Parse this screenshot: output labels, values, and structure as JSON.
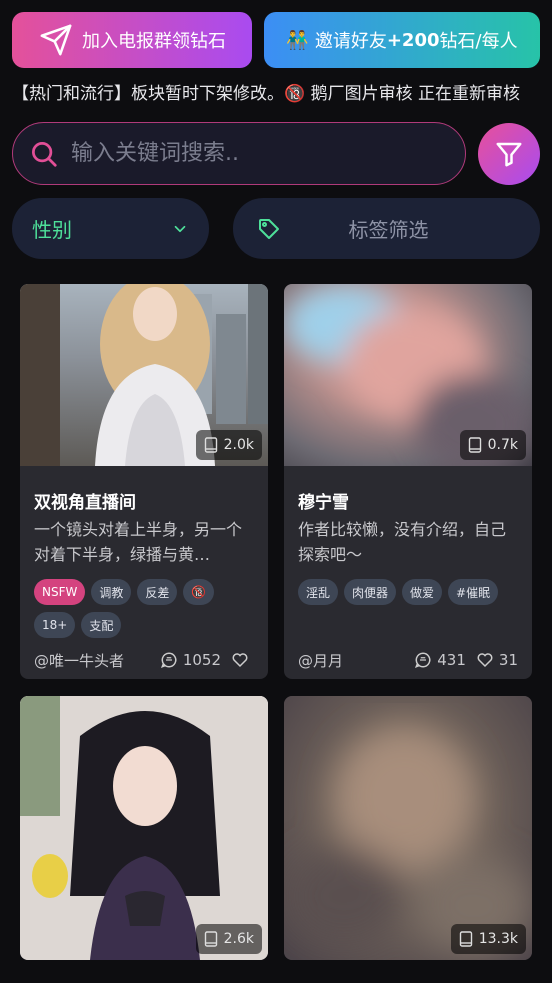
{
  "top_buttons": {
    "telegram_label": "加入电报群领钻石",
    "invite_label_prefix": "邀请好友 ",
    "invite_label_bold": "+200",
    "invite_label_suffix": "钻石/每人",
    "invite_emoji": "👬"
  },
  "announcement": "【热门和流行】板块暂时下架修改。🔞 鹅厂图片审核 正在重新审核",
  "search": {
    "placeholder": "输入关键词搜索.."
  },
  "filters": {
    "gender_label": "性别",
    "tags_label": "标签筛选"
  },
  "cards": [
    {
      "views": "2.0k",
      "title": "双视角直播间",
      "desc": "一个镜头对着上半身，另一个对着下半身，绿播与黄…",
      "tags": [
        "NSFW",
        "调教",
        "反差",
        "🔞",
        "18+",
        "支配"
      ],
      "author": "@唯一牛头者",
      "comments": "1052",
      "likes": ""
    },
    {
      "views": "0.7k",
      "title": "穆宁雪",
      "desc": "作者比较懒，没有介绍，自己探索吧～",
      "tags": [
        "淫乱",
        "肉便器",
        "做爱",
        "#催眠"
      ],
      "author": "@月月",
      "comments": "431",
      "likes": "31"
    },
    {
      "views": "2.6k"
    },
    {
      "views": "13.3k"
    }
  ],
  "colors": {
    "accent_pink": "#e4519a",
    "accent_purple": "#a94bf0",
    "accent_green": "#4ee09a",
    "bg": "#0d0d10"
  }
}
